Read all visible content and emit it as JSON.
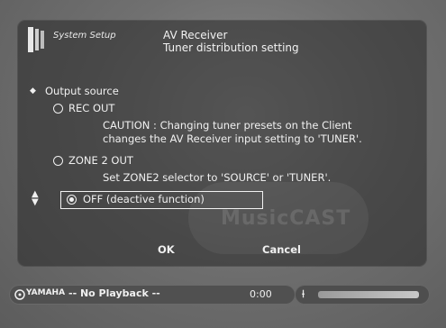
{
  "header": {
    "app_name": "System Setup",
    "title_line1": "AV Receiver",
    "title_line2": "Tuner distribution setting"
  },
  "section": {
    "label": "Output source",
    "options": [
      {
        "label": "REC OUT",
        "selected": false,
        "note_line1": "CAUTION : Changing tuner presets on the Client",
        "note_line2": "changes the AV Receiver input setting to 'TUNER'."
      },
      {
        "label": "ZONE 2 OUT",
        "selected": false,
        "note_line1": "Set ZONE2 selector to 'SOURCE' or 'TUNER'."
      },
      {
        "label": "OFF (deactive function)",
        "selected": true
      }
    ]
  },
  "buttons": {
    "ok": "OK",
    "cancel": "Cancel"
  },
  "watermark": "MusicCAST",
  "statusbar": {
    "brand": "YAMAHA",
    "playback": "-- No Playback --",
    "time": "0:00"
  },
  "icons": {
    "header": "setup-book-icon",
    "bullet": "diamond-bullet-icon",
    "updown": "up-down-arrows-icon",
    "brand": "yamaha-logo-icon",
    "level": "volume-level-icon"
  }
}
